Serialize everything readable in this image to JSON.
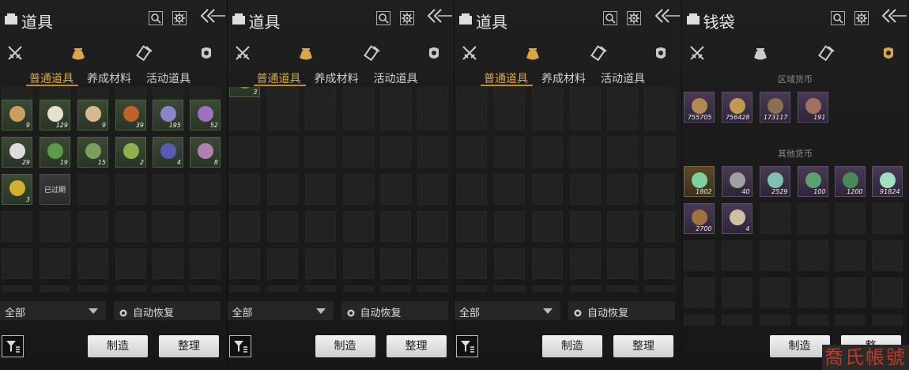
{
  "colors": {
    "accent": "#d9a64a",
    "bg": "#1a1a1a",
    "text": "#dddddd",
    "watermark": "#c0392b"
  },
  "panels": [
    {
      "title": "道具",
      "active_category": 1,
      "subtabs": [
        "普通道具",
        "养成材料",
        "活动道具"
      ],
      "active_subtab": 0,
      "items": [
        {
          "qty": "9",
          "rarity": "green",
          "icon": "gold-ingot-icon",
          "tint": "#c8a060"
        },
        {
          "qty": "129",
          "rarity": "green",
          "icon": "rice-bowl-icon",
          "tint": "#e6e0d0"
        },
        {
          "qty": "9",
          "rarity": "green",
          "icon": "ginger-icon",
          "tint": "#d6b88a"
        },
        {
          "qty": "39",
          "rarity": "green",
          "icon": "meat-icon",
          "tint": "#c0602a"
        },
        {
          "qty": "195",
          "rarity": "green",
          "icon": "flower-icon",
          "tint": "#8a84c8"
        },
        {
          "qty": "52",
          "rarity": "green",
          "icon": "lavender-icon",
          "tint": "#a070c0"
        },
        {
          "qty": "29",
          "rarity": "green",
          "icon": "white-flower-icon",
          "tint": "#dcdcdc"
        },
        {
          "qty": "19",
          "rarity": "green",
          "icon": "herb-icon",
          "tint": "#5a9a48"
        },
        {
          "qty": "15",
          "rarity": "green",
          "icon": "herb-icon",
          "tint": "#7aa060"
        },
        {
          "qty": "2",
          "rarity": "green",
          "icon": "herb-icon",
          "tint": "#90b050"
        },
        {
          "qty": "4",
          "rarity": "green",
          "icon": "violet-icon",
          "tint": "#5a5ab0"
        },
        {
          "qty": "8",
          "rarity": "green",
          "icon": "flower-icon",
          "tint": "#b080b0"
        },
        {
          "qty": "3",
          "rarity": "green",
          "icon": "yellow-herb-icon",
          "tint": "#d0b030"
        },
        {
          "qty": "",
          "rarity": "gray",
          "icon": "expired-item-icon",
          "tint": "#555555",
          "label": "已过期"
        }
      ],
      "select_value": "全部",
      "auto_label": "自动恢复",
      "btn_make": "制造",
      "btn_sort": "整理"
    },
    {
      "title": "道具",
      "active_category": 1,
      "subtabs": [
        "普通道具",
        "养成材料",
        "活动道具"
      ],
      "active_subtab": 0,
      "items": [
        {
          "qty": "3",
          "rarity": "green",
          "icon": "herb-icon",
          "tint": "#5a9a48"
        }
      ],
      "select_value": "全部",
      "auto_label": "自动恢复",
      "btn_make": "制造",
      "btn_sort": "整理"
    },
    {
      "title": "道具",
      "active_category": 1,
      "subtabs": [
        "普通道具",
        "养成材料",
        "活动道具"
      ],
      "active_subtab": 0,
      "items": [],
      "select_value": "全部",
      "auto_label": "自动恢复",
      "btn_make": "制造",
      "btn_sort": "整理"
    },
    {
      "title": "钱袋",
      "active_category": 3,
      "section1": "区域货币",
      "region_items": [
        {
          "qty": "755705",
          "rarity": "purple",
          "icon": "coin-icon",
          "tint": "#b08a50"
        },
        {
          "qty": "756428",
          "rarity": "purple",
          "icon": "coins-icon",
          "tint": "#c09a50"
        },
        {
          "qty": "173117",
          "rarity": "purple",
          "icon": "knife-coin-icon",
          "tint": "#8a7050"
        },
        {
          "qty": "191",
          "rarity": "purple",
          "icon": "copper-coin-icon",
          "tint": "#a07060"
        }
      ],
      "section2": "其他货币",
      "other_items": [
        {
          "qty": "1802",
          "rarity": "gold",
          "icon": "jade-bi-icon",
          "tint": "#7fd0a0"
        },
        {
          "qty": "40",
          "rarity": "purple",
          "icon": "key-coin-icon",
          "tint": "#a0a0a0"
        },
        {
          "qty": "2529",
          "rarity": "purple",
          "icon": "jade-fish-icon",
          "tint": "#80c0b0"
        },
        {
          "qty": "100",
          "rarity": "purple",
          "icon": "jade-leaf-icon",
          "tint": "#5aa070"
        },
        {
          "qty": "1200",
          "rarity": "purple",
          "icon": "green-stone-icon",
          "tint": "#4a8a5a"
        },
        {
          "qty": "91824",
          "rarity": "purple",
          "icon": "jade-pebble-icon",
          "tint": "#a0e0c0"
        },
        {
          "qty": "2700",
          "rarity": "purple",
          "icon": "bronze-bowl-icon",
          "tint": "#a07040"
        },
        {
          "qty": "4",
          "rarity": "purple",
          "icon": "paper-notes-icon",
          "tint": "#d0c0a0"
        }
      ],
      "btn_make": "制造",
      "btn_sort": "整"
    }
  ],
  "watermark": "喬氏帳號"
}
